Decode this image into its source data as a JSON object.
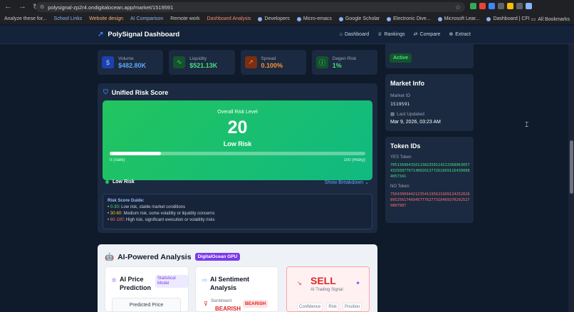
{
  "browser": {
    "url": "polysignal-zp2r4.ondigitalocean.app/market/1519591",
    "bookmarks": [
      "Analyze these for...",
      "School Links",
      "Website design",
      "AI Comparison",
      "Remote work",
      "Dashboard Analysis",
      "Developers",
      "Micro-emacs",
      "Google Scholar",
      "Electronic Dive...",
      "Microsoft Lear...",
      "Dashboard | CFI"
    ],
    "all_bookmarks": "All Bookmarks"
  },
  "header": {
    "brand": "PolySignal Dashboard",
    "nav": [
      "Dashboard",
      "Rankings",
      "Compare",
      "Extract"
    ]
  },
  "stats": [
    {
      "label": "Volume",
      "value": "$482.80K",
      "color": "#60a5fa",
      "icon": "dollar-icon"
    },
    {
      "label": "Liquidity",
      "value": "$521.13K",
      "color": "#4ade80",
      "icon": "pulse-icon"
    },
    {
      "label": "Spread",
      "value": "0.100%",
      "color": "#fb923c",
      "icon": "trend-icon"
    },
    {
      "label": "Degen Risk",
      "value": "1%",
      "color": "#4ade80",
      "icon": "alert-icon"
    }
  ],
  "risk": {
    "title": "Unified Risk Score",
    "overall_label": "Overall Risk Level",
    "score": "20",
    "score_fraction": 0.2,
    "level": "Low Risk",
    "min_label": "0 (Safe)",
    "max_label": "100 (Risky)",
    "status": "Low Risk",
    "breakdown": "Show Breakdown",
    "guide_title": "Risk Score Guide:",
    "guide": [
      {
        "range": "0-30",
        "text": ": Low risk, stable market conditions",
        "color": "#4ade80"
      },
      {
        "range": "30-60",
        "text": ": Medium risk, some volatility or liquidity concerns",
        "color": "#facc15"
      },
      {
        "range": "60-100",
        "text": ": High risk, significant execution or volatility risks",
        "color": "#f87171"
      }
    ]
  },
  "ai": {
    "title": "AI-Powered Analysis",
    "badge": "DigitalOcean GPU",
    "price_title": "AI Price Prediction",
    "model_badge": "Statistical Model",
    "predicted_label": "Predicted Price",
    "sentiment_title": "AI Sentiment Analysis",
    "sentiment_label": "Sentiment",
    "sentiment_value": "BEARISH",
    "bearish_badge": "BEARISH",
    "signal": "SELL",
    "signal_sub": "AI Trading Signal",
    "foot": [
      "Confidence",
      "Risk",
      "Position"
    ]
  },
  "side": {
    "status": "Active",
    "market_info_title": "Market Info",
    "market_id_label": "Market ID",
    "market_id": "1519591",
    "last_updated_label": "Last Updated",
    "last_updated": "Mar 9, 2026, 03:23 AM",
    "token_title": "Token IDs",
    "yes_label": "YES Token",
    "yes_token": "70513696431611382350114213368063057432938776714002013772616691164300084057341",
    "no_label": "NO Token",
    "no_token": "75643009442123541195621609124252028895256174694577762773184693702925279807987"
  }
}
